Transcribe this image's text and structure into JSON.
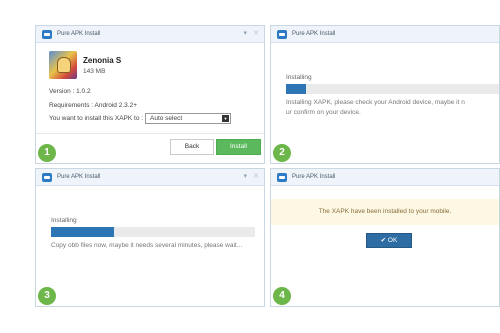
{
  "window_title": "Pure APK Install",
  "controls": {
    "minimize": "▾",
    "close": "✕"
  },
  "steps": {
    "one": "1",
    "two": "2",
    "three": "3",
    "four": "4"
  },
  "step1": {
    "app_name": "Zenonia S",
    "app_size": "143 MB",
    "version": "Version : 1.0.2",
    "requirements": "Requirements : Android 2.3.2+",
    "install_to_label": "You want to install this XAPK to :",
    "install_to_value": "Auto select",
    "back_label": "Back",
    "install_label": "Install"
  },
  "step2": {
    "status": "Installing",
    "progress": 0.09,
    "message_line1": "Installing XAPK, please check your Android device, maybe it n",
    "message_line2": "ur confirm on your device."
  },
  "step3": {
    "status": "Installing",
    "progress": 0.31,
    "message": "Copy obb files now, maybe it needs several minutes, please wait..."
  },
  "step4": {
    "notice": "The XAPK have been installed to your mobile.",
    "ok_label": "OK",
    "ok_icon": "✔"
  },
  "colors": {
    "progress": "#2e75b6",
    "install_button": "#5cb85c",
    "ok_button": "#2e6da4",
    "step_badge": "#6cb64a",
    "notice_bg": "#fcf8e3"
  }
}
